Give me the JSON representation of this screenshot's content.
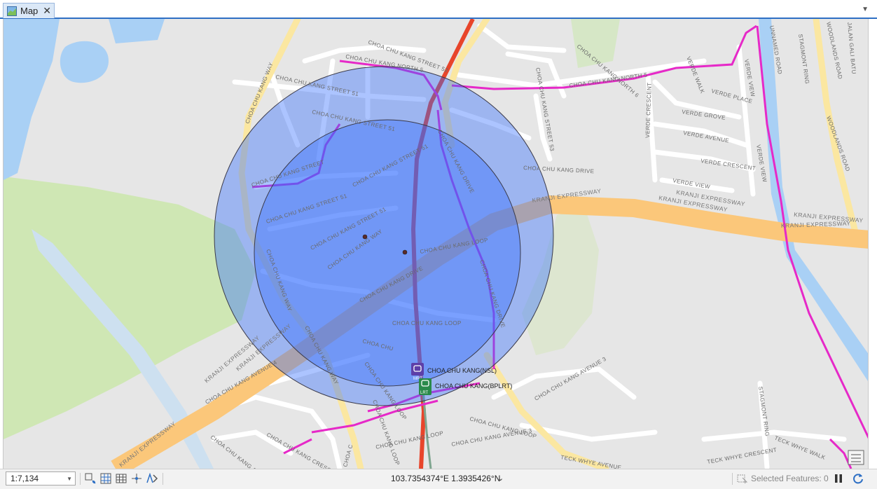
{
  "tab": {
    "title": "Map"
  },
  "map": {
    "road_labels": {
      "choa_chu_kang_street_52": "CHOA CHU KANG STREET 52",
      "choa_chu_kang_north_5": "CHOA CHU KANG NORTH 5",
      "choa_chu_kang_north_6": "CHOA CHU KANG NORTH 6",
      "choa_chu_kang_way": "CHOA CHU KANG WAY",
      "choa_chu_kang_street_51": "CHOA CHU KANG STREET 51",
      "choa_chu_kang_street_53": "CHOA CHU KANG STREET 53",
      "choa_chu_kang_street": "CHOA CHU KANG STREET",
      "choa_chu_kang_drive": "CHOA CHU KANG DRIVE",
      "choa_chu_kang_loop": "CHOA CHU KANG LOOP",
      "choa_chu": "CHOA CHU",
      "choa_chu_kang_avenue_3": "CHOA CHU KANG AVENUE 3",
      "choa_chu_kang_avenue_4": "CHOA CHU KANG AVENUE 4",
      "choa_chu_kang_crescent": "CHOA CHU KANG CRESCENT",
      "verde_walk": "VERDE WALK",
      "verde_place": "VERDE PLACE",
      "verde_view": "VERDE VIEW",
      "verde_grove": "VERDE GROVE",
      "verde_avenue": "VERDE AVENUE",
      "verde_crescent": "VERDE CRESCENT",
      "unnamed_road": "UNNAMED ROAD",
      "stagmont_ring": "STAGMONT RING",
      "woodlands_road": "WOODLANDS ROAD",
      "jalan_gali_batu": "JALAN GALI BATU",
      "kranji_expressway": "KRANJI EXPRESSWAY",
      "teck_whye_walk": "TECK WHYE WALK",
      "teck_whye_crescent": "TECK WHYE CRESCENT",
      "teck_whye_avenue": "TECK WHYE AVENUE",
      "choa_c": "CHOA C"
    },
    "stations": [
      {
        "name": "CHOA CHU KANG(NSL)",
        "badge": "MRT",
        "color": "#5d3fa8"
      },
      {
        "name": "CHOA CHU KANG(BPLRT)",
        "badge": "LRT",
        "color": "#2a8a4a"
      }
    ],
    "colors": {
      "buffer_fill": "#2f6bff",
      "mrt_line": "#e8452b",
      "expressway": "#fbc77a",
      "cycling_path": "#e629c8",
      "water": "#a9d0f5",
      "park": "#cfe7b4"
    }
  },
  "status": {
    "scale": "1:7,134",
    "coordinates": "103.7354374°E 1.3935426°N",
    "selected_features": "Selected Features: 0"
  }
}
